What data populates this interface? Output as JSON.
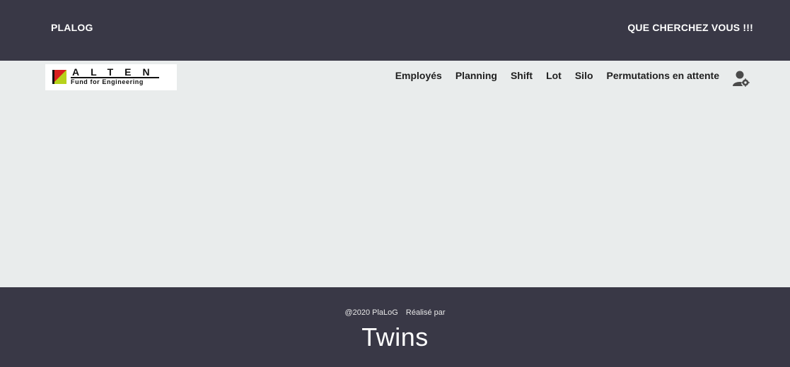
{
  "header": {
    "brand": "PLALOG",
    "tagline": "QUE CHERCHEZ VOUS !!!"
  },
  "logo": {
    "name": "ALTEN",
    "subtitle": "Fund for Engineering",
    "colors": {
      "red": "#d8201f",
      "green": "#b7d21b"
    }
  },
  "nav": {
    "items": [
      {
        "label": "Employés"
      },
      {
        "label": "Planning"
      },
      {
        "label": "Shift"
      },
      {
        "label": "Lot"
      },
      {
        "label": "Silo"
      },
      {
        "label": "Permutations en attente"
      }
    ],
    "user_icon": "user-settings-icon"
  },
  "footer": {
    "copyright": "@2020 PlaLoG",
    "made_by": "Réalisé par",
    "team": "Twins"
  },
  "theme": {
    "dark_bar": "#393846",
    "body_bg": "#e9ecec"
  }
}
